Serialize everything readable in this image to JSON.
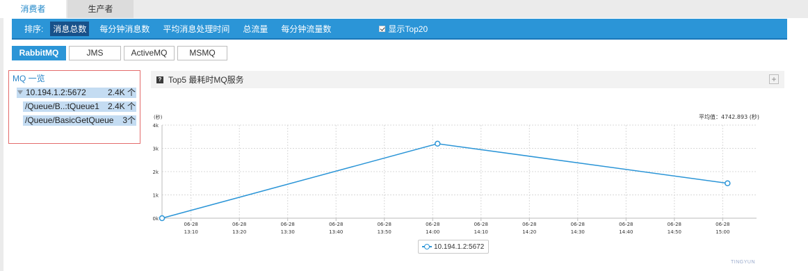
{
  "top_tabs": [
    {
      "label": "消费者",
      "active": true
    },
    {
      "label": "生产者",
      "active": false
    }
  ],
  "sortbar": {
    "label": "排序:",
    "options": [
      "消息总数",
      "每分钟消息数",
      "平均消息处理时间",
      "总流量",
      "每分钟流量数"
    ],
    "active_index": 0,
    "checkbox_label": "显示Top20",
    "checkbox_checked": true
  },
  "mq_tabs": [
    {
      "label": "RabbitMQ",
      "active": true
    },
    {
      "label": "JMS",
      "active": false
    },
    {
      "label": "ActiveMQ",
      "active": false
    },
    {
      "label": "MSMQ",
      "active": false
    }
  ],
  "tree": {
    "title": "MQ 一览",
    "root": {
      "name": "10.194.1.2:5672",
      "count": "2.4K 个"
    },
    "children": [
      {
        "name": "/Queue/B..:tQueue1",
        "count": "2.4K 个"
      },
      {
        "name": "/Queue/BasicGetQueue",
        "count": "3个"
      }
    ]
  },
  "chart_panel": {
    "title": "Top5 最耗时MQ服务",
    "help_icon": "?",
    "expand_icon": "+",
    "avg_text": "平均值：4742.893 (秒)",
    "legend_label": "10.194.1.2:5672"
  },
  "watermark": "TINGYUN",
  "chart_data": {
    "type": "line",
    "title": "Top5 最耗时MQ服务",
    "ylabel": "(秒)",
    "xlabel": "",
    "ylim": [
      0,
      4000
    ],
    "y_ticks": [
      "0k",
      "1k",
      "2k",
      "3k",
      "4k"
    ],
    "x_ticks": [
      "06-28 13:10",
      "06-28 13:20",
      "06-28 13:30",
      "06-28 13:40",
      "06-28 13:50",
      "06-28 14:00",
      "06-28 14:10",
      "06-28 14:20",
      "06-28 14:30",
      "06-28 14:40",
      "06-28 14:50",
      "06-28 15:00"
    ],
    "xlim": [
      "06-28 13:04",
      "06-28 15:07"
    ],
    "series": [
      {
        "name": "10.194.1.2:5672",
        "color": "#2b95d7",
        "points": [
          {
            "x": "06-28 13:04",
            "y": 0
          },
          {
            "x": "06-28 14:01",
            "y": 3200
          },
          {
            "x": "06-28 15:01",
            "y": 1500
          }
        ]
      }
    ],
    "grid": true,
    "legend": "bottom-center"
  }
}
